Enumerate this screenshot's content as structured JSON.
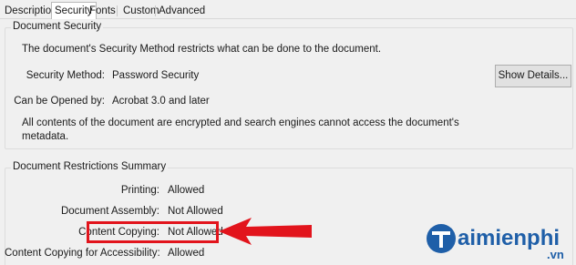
{
  "tabs": [
    {
      "label": "Description",
      "active": false
    },
    {
      "label": "Security",
      "active": true
    },
    {
      "label": "Fonts",
      "active": false
    },
    {
      "label": "Custom",
      "active": false
    },
    {
      "label": "Advanced",
      "active": false
    }
  ],
  "document_security": {
    "title": "Document Security",
    "intro": "The document's Security Method restricts what can be done to the document.",
    "security_method_label": "Security Method:",
    "security_method_value": "Password Security",
    "can_be_opened_label": "Can be Opened by:",
    "can_be_opened_value": "Acrobat 3.0 and later",
    "note_line1": "All contents of the document are encrypted and search engines cannot access the document's",
    "note_line2": "metadata.",
    "show_details_button": "Show Details..."
  },
  "restrictions": {
    "title": "Document Restrictions Summary",
    "items": [
      {
        "label": "Printing:",
        "value": "Allowed"
      },
      {
        "label": "Document Assembly:",
        "value": "Not Allowed"
      },
      {
        "label": "Content Copying:",
        "value": "Not Allowed"
      },
      {
        "label": "Content Copying for Accessibility:",
        "value": "Allowed"
      }
    ]
  },
  "annotation": {
    "highlight_color": "#e2141c",
    "arrow_color": "#e2141c"
  },
  "watermark": {
    "brand": "Taimienphi",
    "domain": ".vn",
    "color": "#1f5fa8"
  }
}
